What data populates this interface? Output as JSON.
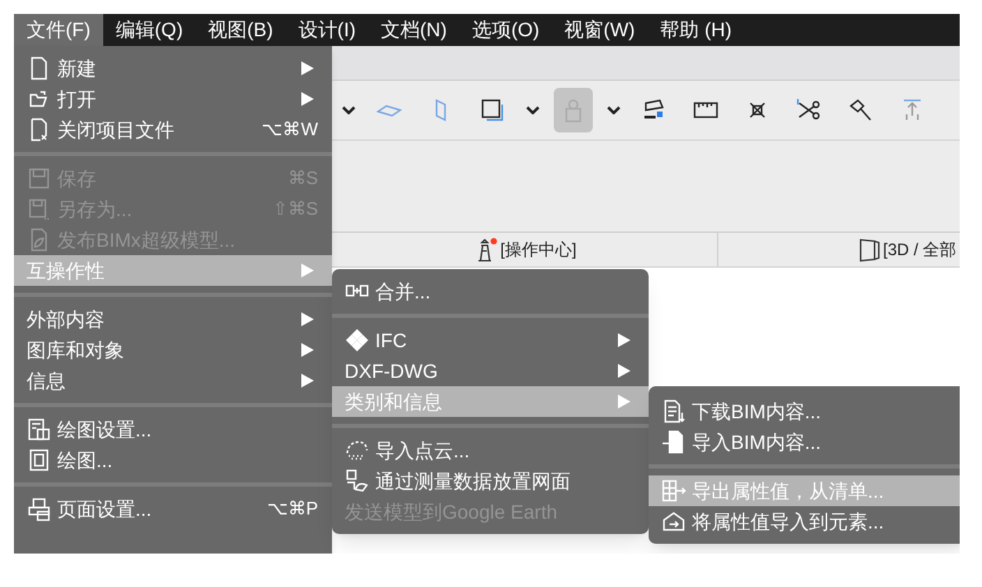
{
  "menu_bar": [
    {
      "label": "文件(F)",
      "selected": true
    },
    {
      "label": "编辑(Q)",
      "selected": false
    },
    {
      "label": "视图(B)",
      "selected": false
    },
    {
      "label": "设计(I)",
      "selected": false
    },
    {
      "label": "文档(N)",
      "selected": false
    },
    {
      "label": "选项(O)",
      "selected": false
    },
    {
      "label": "视窗(W)",
      "selected": false
    },
    {
      "label": "帮助 (H)",
      "selected": false
    }
  ],
  "toolbar": {
    "tools": [
      {
        "selected": false
      },
      {
        "selected": false
      },
      {
        "selected": false
      },
      {
        "selected": false
      },
      {
        "selected": false
      },
      {
        "selected": true
      },
      {
        "selected": false
      },
      {
        "selected": false
      },
      {
        "selected": false
      },
      {
        "selected": false
      },
      {
        "selected": false
      },
      {
        "selected": false
      },
      {
        "selected": false
      }
    ]
  },
  "view_tabs": [
    {
      "label": "[操作中心]"
    },
    {
      "label": "[3D / 全部"
    }
  ],
  "file_menu": {
    "sections": [
      [
        {
          "label": "新建",
          "submenu": true,
          "disabled": false,
          "selected": false
        },
        {
          "label": "打开",
          "submenu": true,
          "disabled": false,
          "selected": false
        },
        {
          "label": "关闭项目文件",
          "shortcut": "⌥⌘W",
          "disabled": false,
          "selected": false
        }
      ],
      [
        {
          "label": "保存",
          "shortcut": "⌘S",
          "disabled": true,
          "selected": false
        },
        {
          "label": "另存为...",
          "shortcut": "⇧⌘S",
          "disabled": true,
          "selected": false
        },
        {
          "label": "发布BIMx超级模型...",
          "disabled": true,
          "selected": false
        },
        {
          "label": "互操作性",
          "submenu": true,
          "disabled": false,
          "selected": true
        }
      ],
      [
        {
          "label": "外部内容",
          "submenu": true,
          "disabled": false,
          "selected": false
        },
        {
          "label": "图库和对象",
          "submenu": true,
          "disabled": false,
          "selected": false
        },
        {
          "label": "信息",
          "submenu": true,
          "disabled": false,
          "selected": false
        }
      ],
      [
        {
          "label": "绘图设置...",
          "disabled": false,
          "selected": false
        },
        {
          "label": "绘图...",
          "disabled": false,
          "selected": false
        }
      ],
      [
        {
          "label": "页面设置...",
          "shortcut": "⌥⌘P",
          "disabled": false,
          "selected": false
        }
      ]
    ]
  },
  "interoperability_menu": {
    "sections": [
      [
        {
          "label": "合并...",
          "disabled": false,
          "selected": false
        }
      ],
      [
        {
          "label": "IFC",
          "submenu": true,
          "disabled": false,
          "selected": false
        },
        {
          "label": "DXF-DWG",
          "submenu": true,
          "disabled": false,
          "selected": false
        },
        {
          "label": "类别和信息",
          "submenu": true,
          "disabled": false,
          "selected": true
        }
      ],
      [
        {
          "label": "导入点云...",
          "disabled": false,
          "selected": false
        },
        {
          "label": "通过测量数据放置网面",
          "disabled": false,
          "selected": false
        },
        {
          "label": "发送模型到Google Earth",
          "disabled": true,
          "selected": false
        }
      ]
    ]
  },
  "classification_menu": {
    "sections": [
      [
        {
          "label": "下载BIM内容...",
          "disabled": false,
          "selected": false
        },
        {
          "label": "导入BIM内容...",
          "disabled": false,
          "selected": false
        }
      ],
      [
        {
          "label": "导出属性值，从清单...",
          "disabled": false,
          "selected": true
        },
        {
          "label": "将属性值导入到元素...",
          "disabled": false,
          "selected": false
        }
      ]
    ]
  }
}
